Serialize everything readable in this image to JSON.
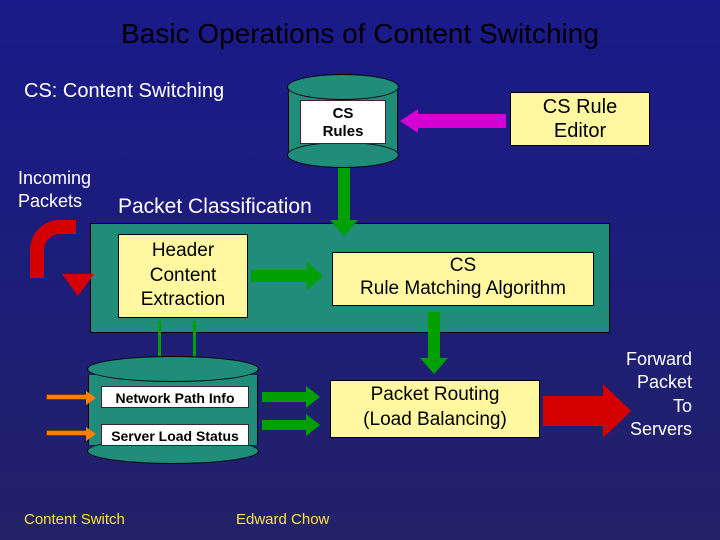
{
  "title": "Basic Operations of Content Switching",
  "subtitle": "CS: Content Switching",
  "incoming": "Incoming\nPackets",
  "cylinder1_label": "CS\nRules",
  "rule_editor": "CS Rule\nEditor",
  "pc_label": "Packet Classification",
  "hce": "Header\nContent\nExtraction",
  "matching": "CS\nRule Matching Algorithm",
  "cylinder2_label1": "Network Path Info",
  "cylinder2_label2": "Server Load Status",
  "routing": "Packet Routing\n(Load Balancing)",
  "forward": "Forward\nPacket\nTo\nServers",
  "footer_left": "Content Switch",
  "footer_mid": "Edward Chow"
}
